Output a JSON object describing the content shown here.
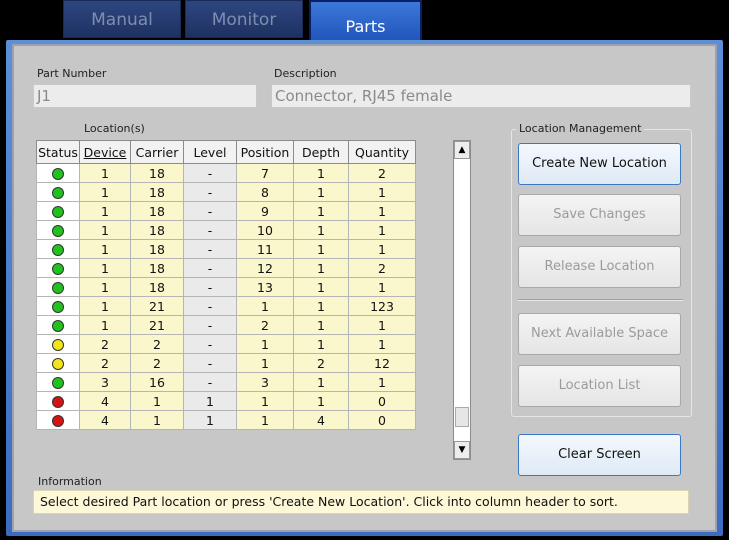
{
  "tabs": [
    "Manual",
    "Monitor",
    "Parts"
  ],
  "part_number_label": "Part Number",
  "part_number_value": "J1",
  "description_label": "Description",
  "description_value": "Connector, RJ45 female",
  "locations_label": "Location(s)",
  "columns": [
    "Status",
    "Device",
    "Carrier",
    "Level",
    "Position",
    "Depth",
    "Quantity"
  ],
  "rows": [
    {
      "status": "green",
      "device": "1",
      "carrier": "18",
      "level": "-",
      "position": "7",
      "depth": "1",
      "quantity": "2"
    },
    {
      "status": "green",
      "device": "1",
      "carrier": "18",
      "level": "-",
      "position": "8",
      "depth": "1",
      "quantity": "1"
    },
    {
      "status": "green",
      "device": "1",
      "carrier": "18",
      "level": "-",
      "position": "9",
      "depth": "1",
      "quantity": "1"
    },
    {
      "status": "green",
      "device": "1",
      "carrier": "18",
      "level": "-",
      "position": "10",
      "depth": "1",
      "quantity": "1"
    },
    {
      "status": "green",
      "device": "1",
      "carrier": "18",
      "level": "-",
      "position": "11",
      "depth": "1",
      "quantity": "1"
    },
    {
      "status": "green",
      "device": "1",
      "carrier": "18",
      "level": "-",
      "position": "12",
      "depth": "1",
      "quantity": "2"
    },
    {
      "status": "green",
      "device": "1",
      "carrier": "18",
      "level": "-",
      "position": "13",
      "depth": "1",
      "quantity": "1"
    },
    {
      "status": "green",
      "device": "1",
      "carrier": "21",
      "level": "-",
      "position": "1",
      "depth": "1",
      "quantity": "123"
    },
    {
      "status": "green",
      "device": "1",
      "carrier": "21",
      "level": "-",
      "position": "2",
      "depth": "1",
      "quantity": "1"
    },
    {
      "status": "yellow",
      "device": "2",
      "carrier": "2",
      "level": "-",
      "position": "1",
      "depth": "1",
      "quantity": "1"
    },
    {
      "status": "yellow",
      "device": "2",
      "carrier": "2",
      "level": "-",
      "position": "1",
      "depth": "2",
      "quantity": "12"
    },
    {
      "status": "green",
      "device": "3",
      "carrier": "16",
      "level": "-",
      "position": "3",
      "depth": "1",
      "quantity": "1"
    },
    {
      "status": "red",
      "device": "4",
      "carrier": "1",
      "level": "1",
      "position": "1",
      "depth": "1",
      "quantity": "0"
    },
    {
      "status": "red",
      "device": "4",
      "carrier": "1",
      "level": "1",
      "position": "1",
      "depth": "4",
      "quantity": "0"
    }
  ],
  "status_colors": {
    "green": "#22c21e",
    "yellow": "#f2e51a",
    "red": "#d41414"
  },
  "location_management_label": "Location Management",
  "buttons": {
    "create_new_location": "Create New Location",
    "save_changes": "Save Changes",
    "release_location": "Release Location",
    "next_available_space": "Next Available Space",
    "location_list": "Location List",
    "clear_screen": "Clear Screen"
  },
  "information_label": "Information",
  "information_text": "Select desired Part location or press 'Create New Location'. Click into column header to sort."
}
